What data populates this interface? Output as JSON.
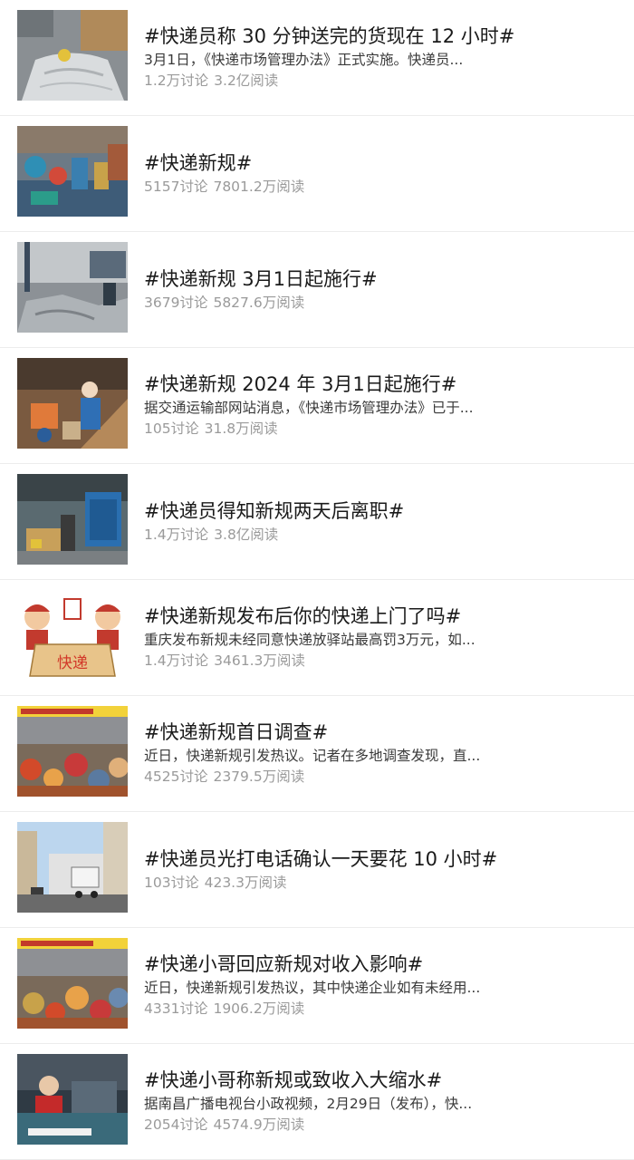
{
  "topics": [
    {
      "title": "#快递员称 30 分钟送完的货现在 12 小时#",
      "desc": "3月1日，《快递市场管理办法》正式实施。快递员...",
      "discussions": "1.2万讨论",
      "reads": "3.2亿阅读",
      "thumb_icon": "parcel-sack-image"
    },
    {
      "title": "#快递新规#",
      "desc": "",
      "discussions": "5157讨论",
      "reads": "7801.2万阅读",
      "thumb_icon": "sorting-station-image"
    },
    {
      "title": "#快递新规 3月1日起施行#",
      "desc": "",
      "discussions": "3679讨论",
      "reads": "5827.6万阅读",
      "thumb_icon": "warehouse-image"
    },
    {
      "title": "#快递新规 2024 年 3月1日起施行#",
      "desc": "据交通运输部网站消息，《快递市场管理办法》已于...",
      "discussions": "105讨论",
      "reads": "31.8万阅读",
      "thumb_icon": "courier-sorting-image"
    },
    {
      "title": "#快递员得知新规两天后离职#",
      "desc": "",
      "discussions": "1.4万讨论",
      "reads": "3.8亿阅读",
      "thumb_icon": "depot-image"
    },
    {
      "title": "#快递新规发布后你的快递上门了吗#",
      "desc": "重庆发布新规未经同意快递放驿站最高罚3万元，如...",
      "discussions": "1.4万讨论",
      "reads": "3461.3万阅读",
      "thumb_icon": "cartoon-courier-image",
      "thumb_box_text": "快递"
    },
    {
      "title": "#快递新规首日调查#",
      "desc": "近日，快递新规引发热议。记者在多地调查发现，直...",
      "discussions": "4525讨论",
      "reads": "2379.5万阅读",
      "thumb_icon": "parcel-pile-image"
    },
    {
      "title": "#快递员光打电话确认一天要花 10 小时#",
      "desc": "",
      "discussions": "103讨论",
      "reads": "423.3万阅读",
      "thumb_icon": "street-truck-image"
    },
    {
      "title": "#快递小哥回应新规对收入影响#",
      "desc": "近日，快递新规引发热议，其中快递企业如有未经用...",
      "discussions": "4331讨论",
      "reads": "1906.2万阅读",
      "thumb_icon": "parcel-pile-image"
    },
    {
      "title": "#快递小哥称新规或致收入大缩水#",
      "desc": "据南昌广播电视台小政视频，2月29日（发布），快...",
      "discussions": "2054讨论",
      "reads": "4574.9万阅读",
      "thumb_icon": "video-interview-image"
    }
  ]
}
